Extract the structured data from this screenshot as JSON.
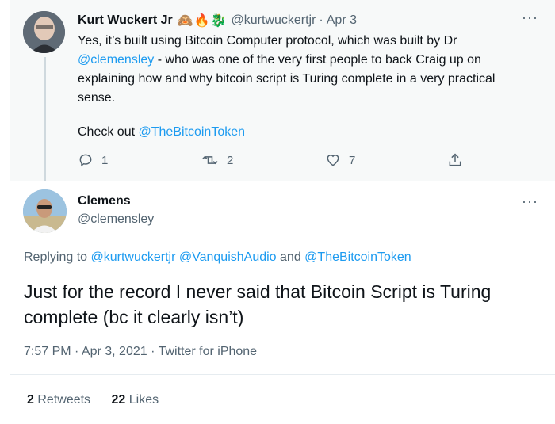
{
  "parent_tweet": {
    "author_name": "Kurt Wuckert Jr",
    "emoji": [
      "🙈",
      "🔥",
      "🐉"
    ],
    "handle": "@kurtwuckertjr",
    "separator": "·",
    "date": "Apr 3",
    "more_label": "···",
    "text_line_1": "Yes, it’s built using Bitcoin Computer protocol, which was built by Dr",
    "text_mention_1": "@clemensley",
    "text_line_2_rest": " - who was one of the very first people to back Craig up on",
    "text_line_3": "explaining how and why bitcoin script is Turing complete in a very practical",
    "text_line_4": "sense.",
    "check_out_prefix": "Check out ",
    "check_out_mention": "@TheBitcoinToken",
    "actions": {
      "reply_count": "1",
      "retweet_count": "2",
      "like_count": "7"
    }
  },
  "main_tweet": {
    "author_name": "Clemens",
    "handle": "@clemensley",
    "more_label": "···",
    "replying_prefix": "Replying to ",
    "replying_mention_1": "@kurtwuckertjr",
    "replying_mention_2": "@VanquishAudio",
    "replying_and": " and ",
    "replying_mention_3": "@TheBitcoinToken",
    "text": "Just for the record I never said that Bitcoin Script is Turing complete (bc it clearly isn’t)",
    "time": "7:57 PM · Apr 3, 2021 · Twitter for iPhone",
    "retweets_count": "2",
    "retweets_label": "Retweets",
    "likes_count": "22",
    "likes_label": "Likes"
  },
  "colors": {
    "link": "#1d9bf0",
    "secondary_text": "#536471",
    "primary_text": "#0f1419",
    "parent_bg": "#f7f9f9"
  }
}
